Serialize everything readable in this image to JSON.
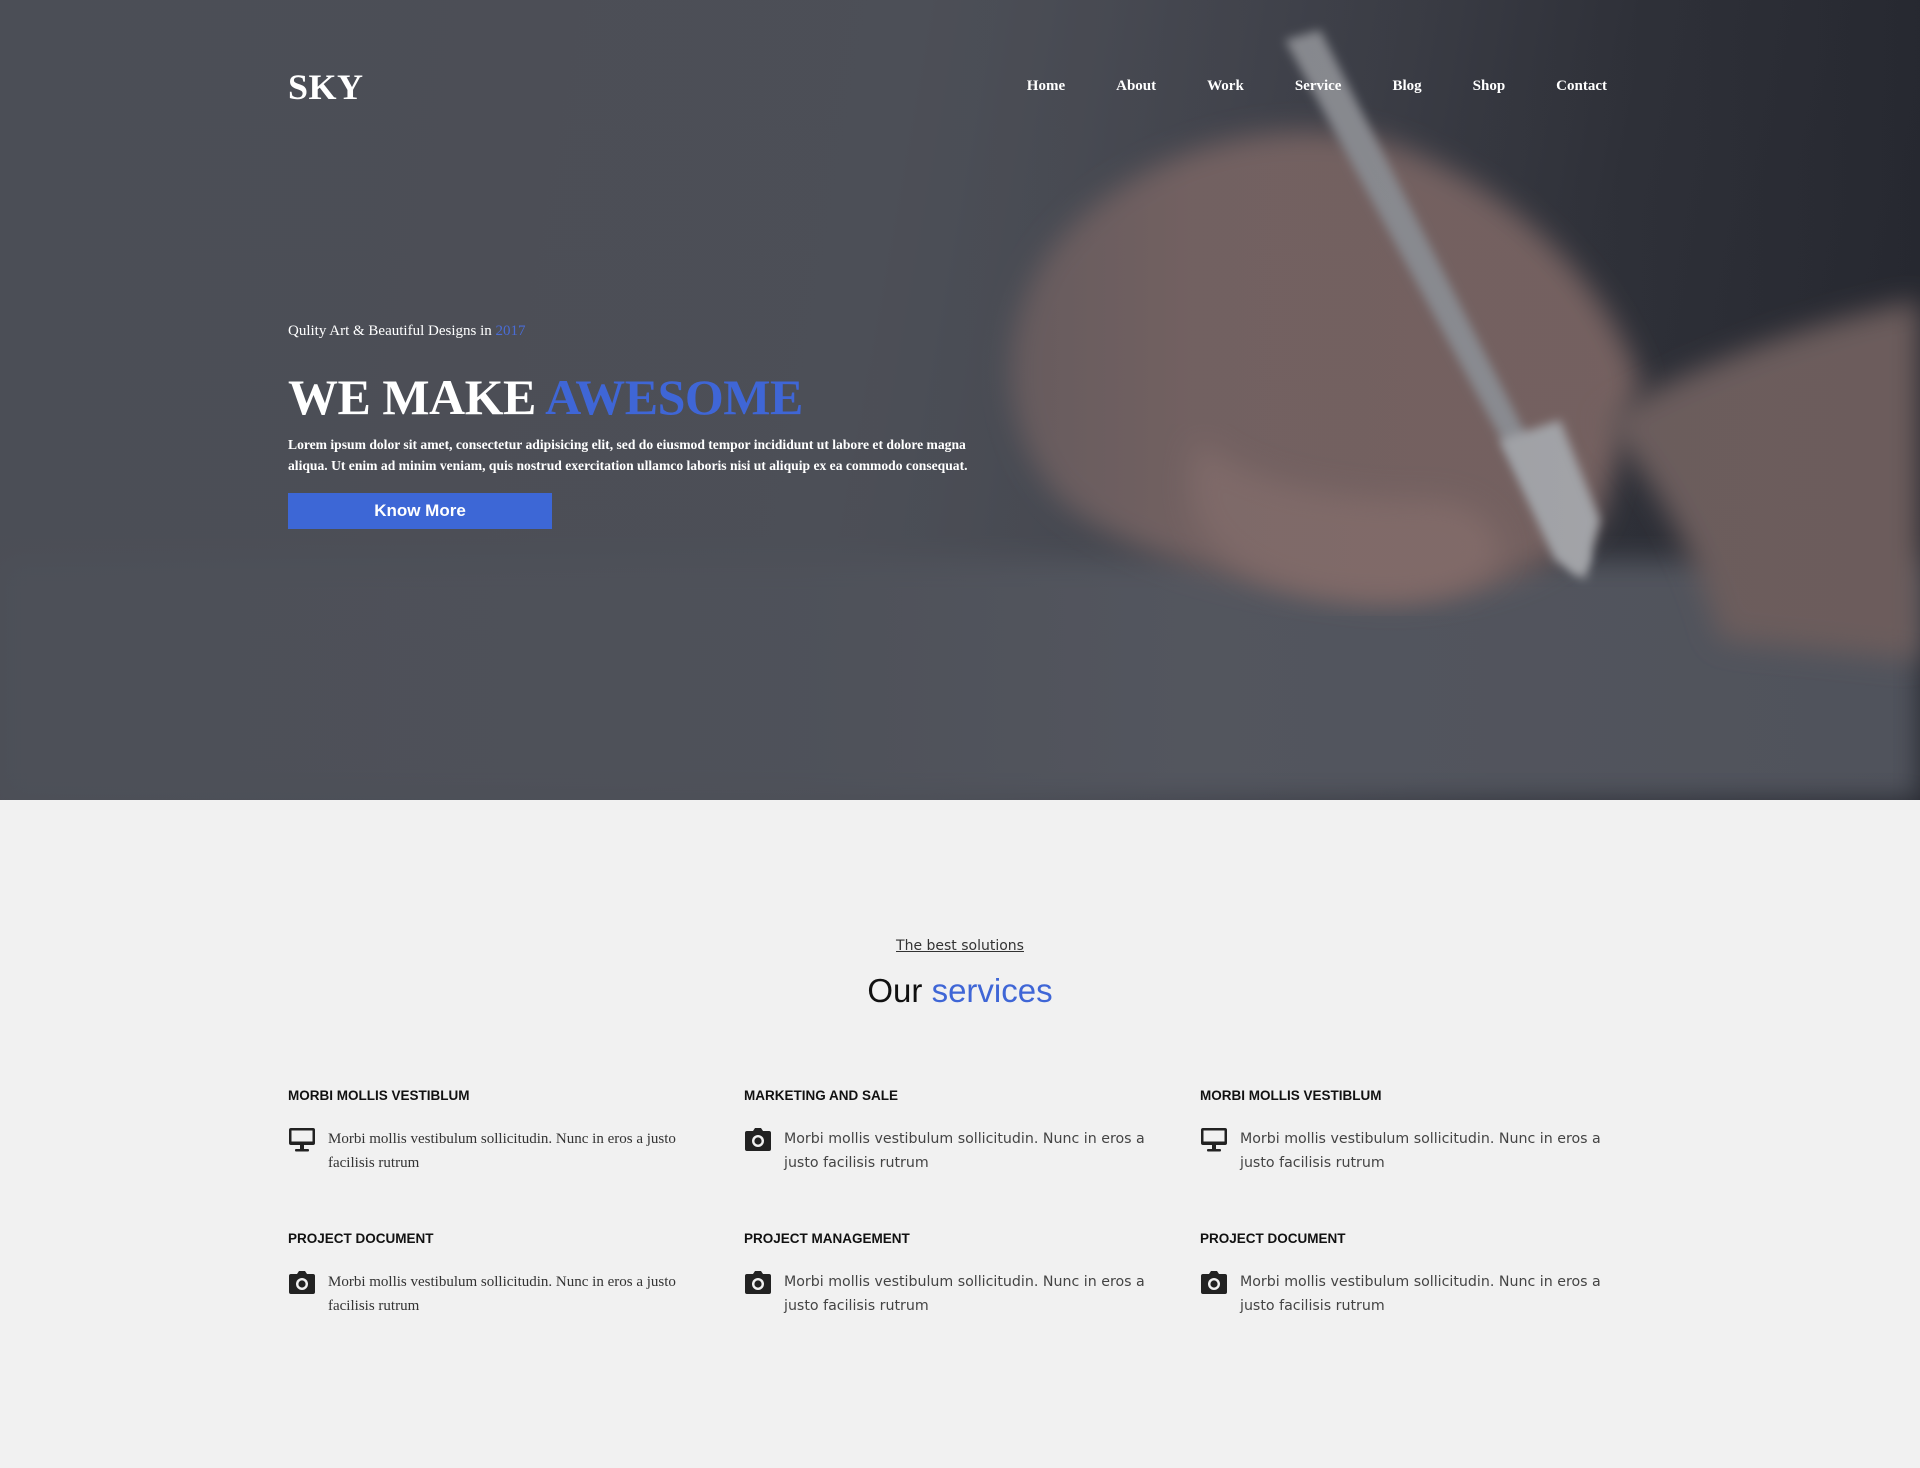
{
  "brand": {
    "logo": "SKY"
  },
  "nav": {
    "items": [
      {
        "label": "Home"
      },
      {
        "label": "About"
      },
      {
        "label": "Work"
      },
      {
        "label": "Service"
      },
      {
        "label": "Blog"
      },
      {
        "label": "Shop"
      },
      {
        "label": "Contact"
      }
    ]
  },
  "hero": {
    "subtitle": "Qulity Art & Beautiful Designs in",
    "year": "2017",
    "title_plain": "WE MAKE",
    "title_accent": "AWESOME",
    "description": "Lorem ipsum dolor sit amet, consectetur adipisicing elit, sed do eiusmod tempor incididunt ut labore et dolore magna aliqua. Ut enim ad minim veniam, quis nostrud exercitation ullamco laboris nisi ut aliquip ex ea commodo consequat.",
    "cta_label": "Know More"
  },
  "services": {
    "kicker": "The best solutions",
    "title_plain": "Our",
    "title_accent": "services",
    "items": [
      {
        "title": "MORBI MOLLIS VESTIBLUM",
        "icon": "desktop-icon",
        "text": "Morbi mollis vestibulum sollicitudin. Nunc in eros a justo facilisis rutrum"
      },
      {
        "title": "MARKETING AND SALE",
        "icon": "camera-icon",
        "text": "Morbi mollis vestibulum sollicitudin. Nunc in eros a justo facilisis rutrum"
      },
      {
        "title": "MORBI MOLLIS VESTIBLUM",
        "icon": "desktop-icon",
        "text": "Morbi mollis vestibulum sollicitudin. Nunc in eros a justo facilisis rutrum"
      },
      {
        "title": "PROJECT DOCUMENT",
        "icon": "camera-icon",
        "text": "Morbi mollis vestibulum sollicitudin. Nunc in eros a justo facilisis rutrum"
      },
      {
        "title": "PROJECT MANAGEMENT",
        "icon": "camera-icon",
        "text": "Morbi mollis vestibulum sollicitudin. Nunc in eros a justo facilisis rutrum"
      },
      {
        "title": "PROJECT DOCUMENT",
        "icon": "camera-icon",
        "text": "Morbi mollis vestibulum sollicitudin. Nunc in eros a justo facilisis rutrum"
      }
    ]
  },
  "colors": {
    "accent": "#3f66d6",
    "hero_overlay": "#4b4e56",
    "page_background": "#f1f1f1"
  }
}
